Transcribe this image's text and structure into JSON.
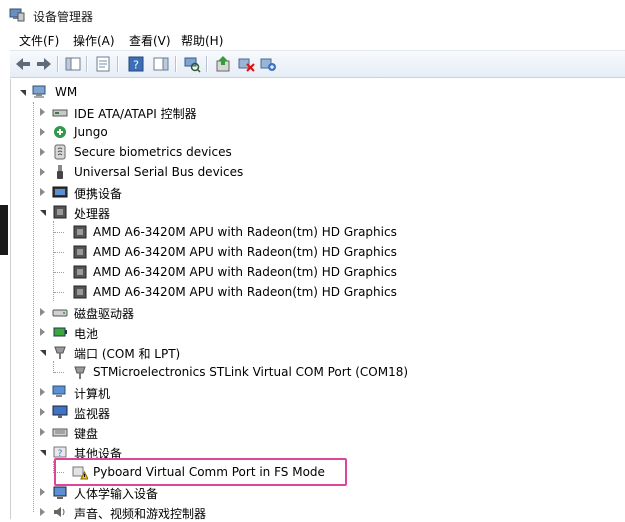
{
  "window": {
    "title": "设备管理器",
    "app_icon": "device-manager-icon"
  },
  "menu": [
    {
      "label": "文件(F)"
    },
    {
      "label": "操作(A)"
    },
    {
      "label": "查看(V)"
    },
    {
      "label": "帮助(H)"
    }
  ],
  "toolbar": {
    "buttons": [
      "back-icon",
      "forward-icon",
      "show-hide-tree-icon",
      "properties-icon",
      "help-icon",
      "action-pane-icon",
      "scan-hardware-icon",
      "update-driver-icon",
      "uninstall-icon",
      "enable-device-icon"
    ]
  },
  "tree": {
    "root": "WM",
    "nodes": [
      {
        "label": "IDE ATA/ATAPI 控制器",
        "icon": "ide-controller-icon"
      },
      {
        "label": "Jungo",
        "icon": "jungo-icon"
      },
      {
        "label": "Secure biometrics devices",
        "icon": "biometrics-icon"
      },
      {
        "label": "Universal Serial Bus devices",
        "icon": "usb-icon"
      },
      {
        "label": "便携设备",
        "icon": "portable-device-icon"
      },
      {
        "label": "处理器",
        "icon": "processor-icon"
      },
      {
        "label": "AMD A6-3420M APU with Radeon(tm) HD Graphics",
        "icon": "cpu-chip-icon"
      },
      {
        "label": "AMD A6-3420M APU with Radeon(tm) HD Graphics",
        "icon": "cpu-chip-icon"
      },
      {
        "label": "AMD A6-3420M APU with Radeon(tm) HD Graphics",
        "icon": "cpu-chip-icon"
      },
      {
        "label": "AMD A6-3420M APU with Radeon(tm) HD Graphics",
        "icon": "cpu-chip-icon"
      },
      {
        "label": "磁盘驱动器",
        "icon": "disk-drive-icon"
      },
      {
        "label": "电池",
        "icon": "battery-icon"
      },
      {
        "label": "端口 (COM 和 LPT)",
        "icon": "port-icon"
      },
      {
        "label": "STMicroelectronics STLink Virtual COM Port (COM18)",
        "icon": "com-port-icon"
      },
      {
        "label": "计算机",
        "icon": "computer-icon"
      },
      {
        "label": "监视器",
        "icon": "monitor-icon"
      },
      {
        "label": "键盘",
        "icon": "keyboard-icon"
      },
      {
        "label": "其他设备",
        "icon": "other-devices-icon"
      },
      {
        "label": "Pyboard Virtual Comm Port in FS Mode",
        "icon": "warning-device-icon"
      },
      {
        "label": "人体学输入设备",
        "icon": "hid-icon"
      },
      {
        "label": "声音、视频和游戏控制器",
        "icon": "sound-icon"
      }
    ]
  }
}
